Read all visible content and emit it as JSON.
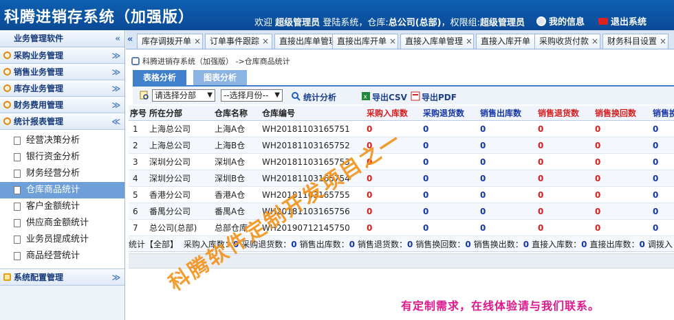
{
  "header": {
    "title": "科腾进销存系统（加强版）",
    "welcome_prefix": "欢迎",
    "user_role": "超级管理员",
    "login_text": "登陆系统，仓库:",
    "warehouse": "总公司(总部)",
    "perm_text": "，权限组:",
    "perm_group": "超级管理员",
    "my_info": "我的信息",
    "logout": "退出系统"
  },
  "sidebar": {
    "top_label": "业务管理软件",
    "sections": [
      {
        "label": "采购业务管理"
      },
      {
        "label": "销售业务管理"
      },
      {
        "label": "库存业务管理"
      },
      {
        "label": "财务费用管理"
      },
      {
        "label": "统计报表管理"
      }
    ],
    "items": [
      {
        "label": "经营决策分析"
      },
      {
        "label": "银行资金分析"
      },
      {
        "label": "财务经营分析"
      },
      {
        "label": "仓库商品统计"
      },
      {
        "label": "客户金额统计"
      },
      {
        "label": "供应商金额统计"
      },
      {
        "label": "业务员提成统计"
      },
      {
        "label": "商品经营统计"
      }
    ],
    "bottom_section": "系统配置管理"
  },
  "tabs": [
    {
      "label": "库存调拨开单"
    },
    {
      "label": "订单事件跟踪"
    },
    {
      "label": "直接出库单管理"
    },
    {
      "label": "直接出库开单"
    },
    {
      "label": "直接入库单管理"
    },
    {
      "label": "直接入库开单"
    },
    {
      "label": "采购收货付款"
    },
    {
      "label": "财务科目设置"
    }
  ],
  "breadcrumb": "科腾进销存系统（加强版） ->仓库商品统计",
  "subtabs": {
    "table": "表格分析",
    "chart": "图表分析"
  },
  "toolbar": {
    "branch_select": "请选择分部",
    "month_select": "--选择月份--",
    "stat_btn": "统计分析",
    "export_csv": "导出CSV",
    "export_pdf": "导出PDF"
  },
  "table": {
    "headers": [
      "序号",
      "所在分部",
      "仓库名称",
      "仓库编号",
      "采购入库数",
      "采购退货数",
      "销售出库数",
      "销售退货数",
      "销售换回数",
      "销售换"
    ],
    "rows": [
      [
        "1",
        "上海总公司",
        "上海A仓",
        "WH20181103165751",
        "0",
        "0",
        "0",
        "0",
        "0",
        "0"
      ],
      [
        "2",
        "上海总公司",
        "上海B仓",
        "WH20181103165752",
        "0",
        "0",
        "0",
        "0",
        "0",
        "0"
      ],
      [
        "3",
        "深圳分公司",
        "深圳A仓",
        "WH20181103165753",
        "0",
        "0",
        "0",
        "0",
        "0",
        "0"
      ],
      [
        "4",
        "深圳分公司",
        "深圳B仓",
        "WH20181103165754",
        "0",
        "0",
        "0",
        "0",
        "0",
        "0"
      ],
      [
        "5",
        "香港分公司",
        "香港A仓",
        "WH20181103165755",
        "0",
        "0",
        "0",
        "0",
        "0",
        "0"
      ],
      [
        "6",
        "番禺分公司",
        "番禺A仓",
        "WH20181103165756",
        "0",
        "0",
        "0",
        "0",
        "0",
        "0"
      ],
      [
        "7",
        "总公司(总部)",
        "总部仓库",
        "WH20190712145750",
        "0",
        "0",
        "0",
        "0",
        "0",
        "0"
      ]
    ]
  },
  "summary": {
    "prefix": "统计【全部】",
    "items": [
      {
        "label": "采购入库数：",
        "value": "0"
      },
      {
        "label": "采购退货数：",
        "value": "0"
      },
      {
        "label": "销售出库数：",
        "value": "0"
      },
      {
        "label": "销售退货数：",
        "value": "0"
      },
      {
        "label": "销售换回数：",
        "value": "0"
      },
      {
        "label": "销售换出数：",
        "value": "0"
      },
      {
        "label": "直接入库数：",
        "value": "0"
      },
      {
        "label": "直接出库数：",
        "value": "0"
      },
      {
        "label": "调拨入",
        "value": ""
      }
    ]
  },
  "watermark": "科腾软件定制开发项目之一",
  "contact": "有定制需求，在线体验请与我们联系。",
  "colors": {
    "header_bg": "#0b4e9c",
    "active_item": "#6f9fd8",
    "red": "#d61e1e",
    "blue": "#1636a8",
    "watermark": "#f2921a",
    "contact": "#e0178c"
  }
}
